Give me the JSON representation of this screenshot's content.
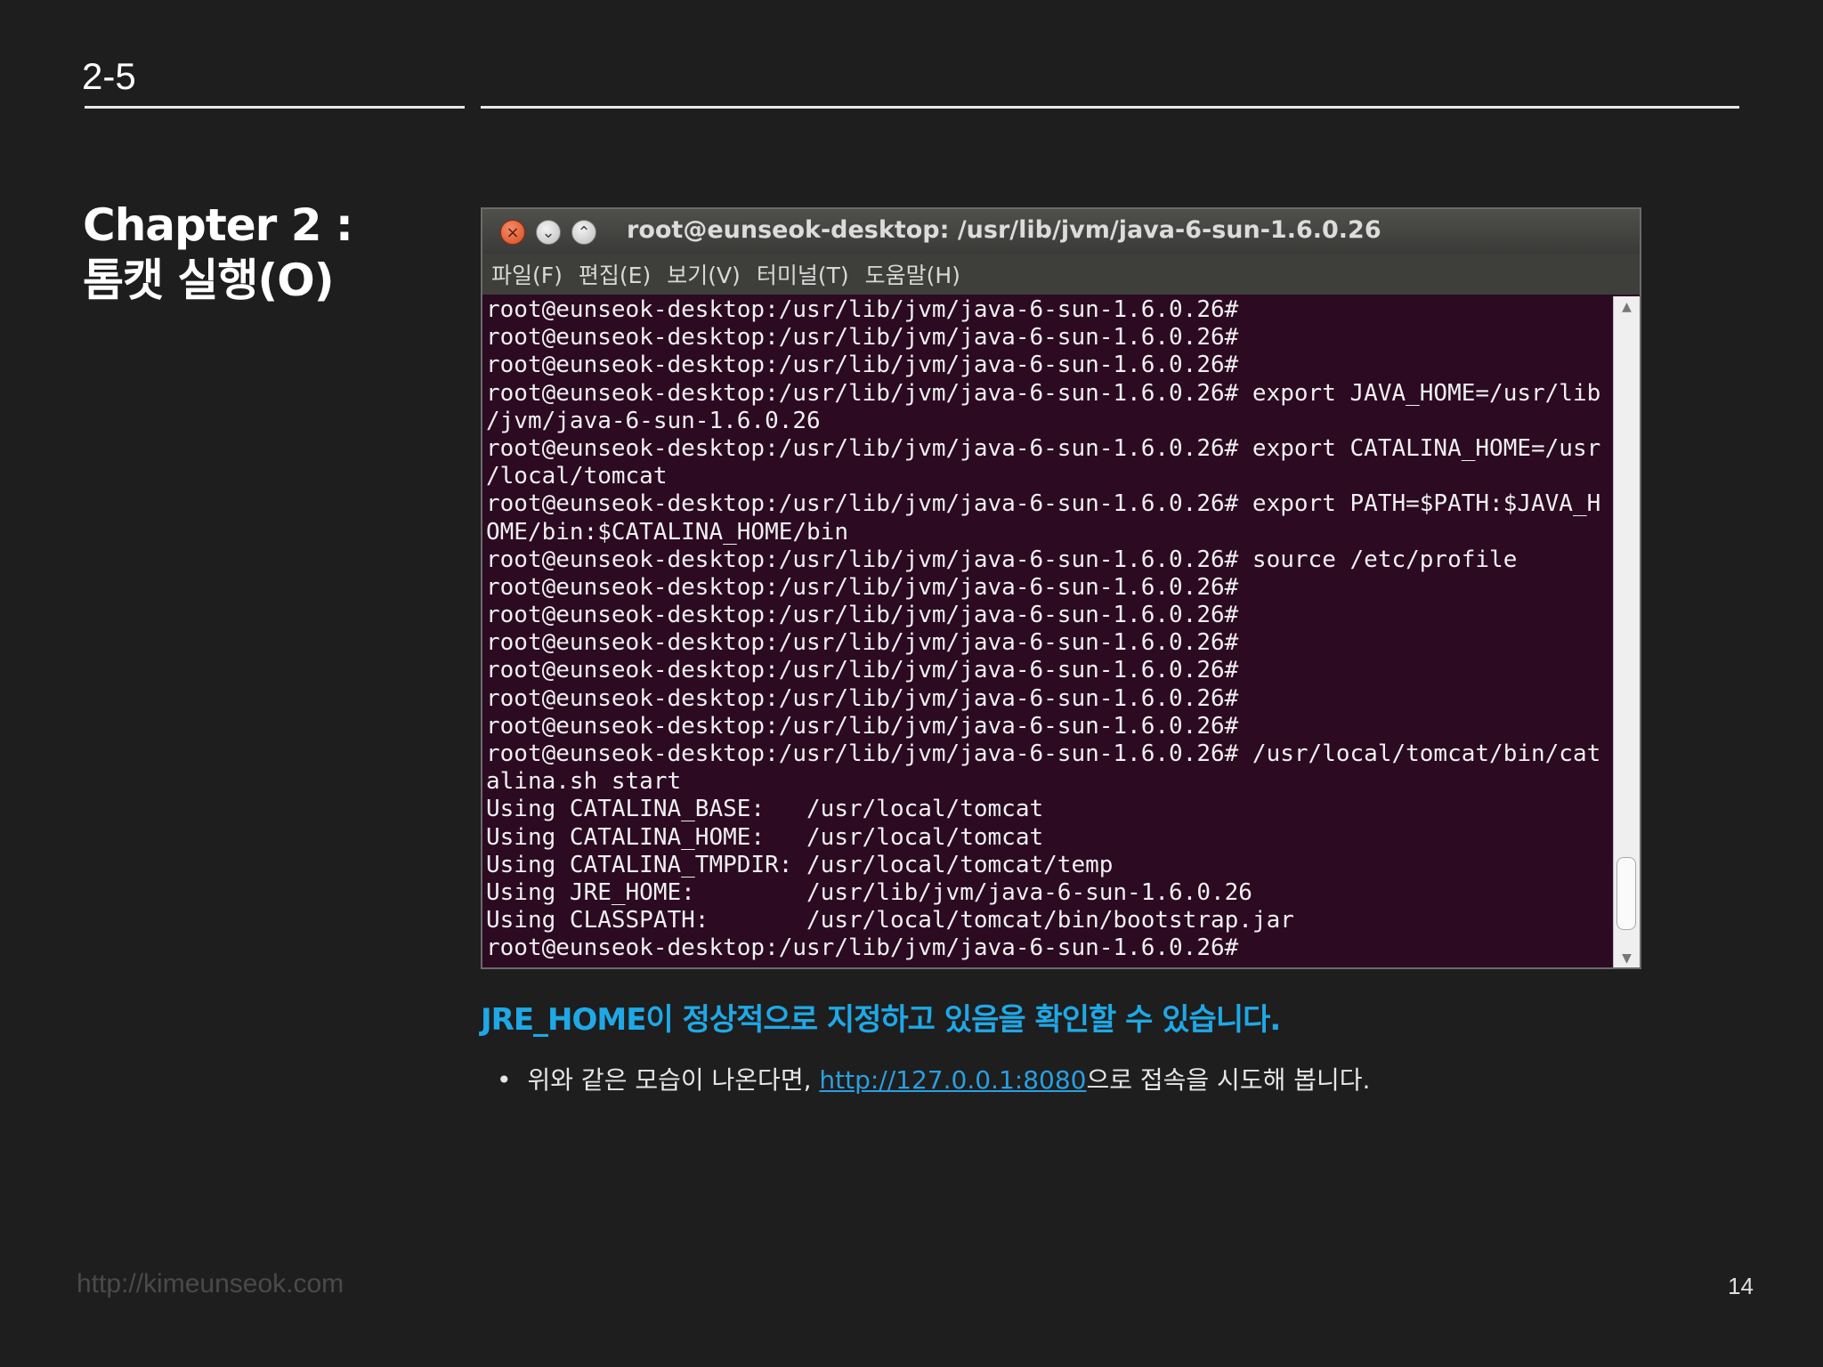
{
  "header": {
    "section_number": "2-5"
  },
  "chapter": {
    "title_line1": "Chapter 2 :",
    "title_line2": "톰캣 실행(O)"
  },
  "terminal": {
    "window_title": "root@eunseok-desktop: /usr/lib/jvm/java-6-sun-1.6.0.26",
    "buttons": {
      "close_glyph": "×",
      "minimize_glyph": "⌄",
      "maximize_glyph": "⌃"
    },
    "menu": [
      "파일(F)",
      "편집(E)",
      "보기(V)",
      "터미널(T)",
      "도움말(H)"
    ],
    "lines": [
      "root@eunseok-desktop:/usr/lib/jvm/java-6-sun-1.6.0.26#",
      "root@eunseok-desktop:/usr/lib/jvm/java-6-sun-1.6.0.26#",
      "root@eunseok-desktop:/usr/lib/jvm/java-6-sun-1.6.0.26#",
      "root@eunseok-desktop:/usr/lib/jvm/java-6-sun-1.6.0.26# export JAVA_HOME=/usr/lib",
      "/jvm/java-6-sun-1.6.0.26",
      "root@eunseok-desktop:/usr/lib/jvm/java-6-sun-1.6.0.26# export CATALINA_HOME=/usr",
      "/local/tomcat",
      "root@eunseok-desktop:/usr/lib/jvm/java-6-sun-1.6.0.26# export PATH=$PATH:$JAVA_H",
      "OME/bin:$CATALINA_HOME/bin",
      "root@eunseok-desktop:/usr/lib/jvm/java-6-sun-1.6.0.26# source /etc/profile",
      "root@eunseok-desktop:/usr/lib/jvm/java-6-sun-1.6.0.26#",
      "root@eunseok-desktop:/usr/lib/jvm/java-6-sun-1.6.0.26#",
      "root@eunseok-desktop:/usr/lib/jvm/java-6-sun-1.6.0.26#",
      "root@eunseok-desktop:/usr/lib/jvm/java-6-sun-1.6.0.26#",
      "root@eunseok-desktop:/usr/lib/jvm/java-6-sun-1.6.0.26#",
      "root@eunseok-desktop:/usr/lib/jvm/java-6-sun-1.6.0.26#",
      "root@eunseok-desktop:/usr/lib/jvm/java-6-sun-1.6.0.26# /usr/local/tomcat/bin/cat",
      "alina.sh start",
      "Using CATALINA_BASE:   /usr/local/tomcat",
      "Using CATALINA_HOME:   /usr/local/tomcat",
      "Using CATALINA_TMPDIR: /usr/local/tomcat/temp",
      "Using JRE_HOME:        /usr/lib/jvm/java-6-sun-1.6.0.26",
      "Using CLASSPATH:       /usr/local/tomcat/bin/bootstrap.jar",
      "root@eunseok-desktop:/usr/lib/jvm/java-6-sun-1.6.0.26#"
    ],
    "scrollbar": {
      "up_glyph": "▲",
      "down_glyph": "▼"
    }
  },
  "content": {
    "highlight": "JRE_HOME이 정상적으로 지정하고 있음을 확인할 수 있습니다.",
    "bullet_glyph": "•",
    "bullet_prefix": "위와 같은 모습이 나온다면, ",
    "bullet_link": "http://127.0.0.1:8080",
    "bullet_suffix": "으로 접속을 시도해 봅니다."
  },
  "footer": {
    "url": "http://kimeunseok.com",
    "page_number": "14"
  },
  "colors": {
    "background": "#1e1e1e",
    "terminal_bg": "#2b0a22",
    "accent_blue": "#1fa8e6",
    "link_blue": "#2a9fe0"
  }
}
